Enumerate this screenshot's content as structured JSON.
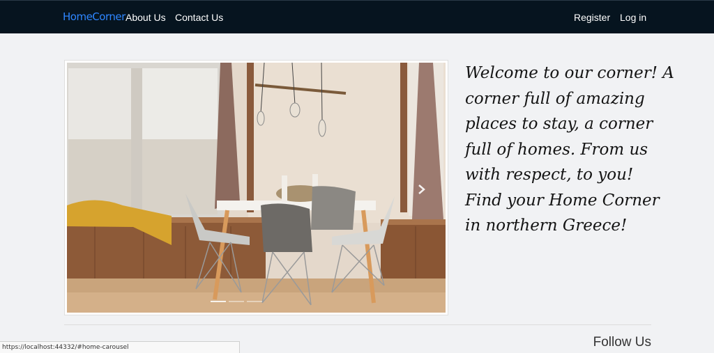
{
  "navbar": {
    "brand": "HomeCorner",
    "links": [
      {
        "label": "About Us"
      },
      {
        "label": "Contact Us"
      }
    ],
    "auth": {
      "register": "Register",
      "login": "Log in"
    }
  },
  "hero": {
    "welcome_text": "Welcome to our corner! A corner full of amazing places to stay, a corner full of homes. From us with respect, to you! Find your Home Corner in northern Greece!"
  },
  "footer": {
    "follow_us": "Follow Us"
  },
  "status_bar": {
    "url": "https://localhost:44332/#home-carousel"
  },
  "colors": {
    "navbar_bg": "#06141f",
    "brand": "#2e86ff",
    "page_bg": "#f1f2f4"
  }
}
